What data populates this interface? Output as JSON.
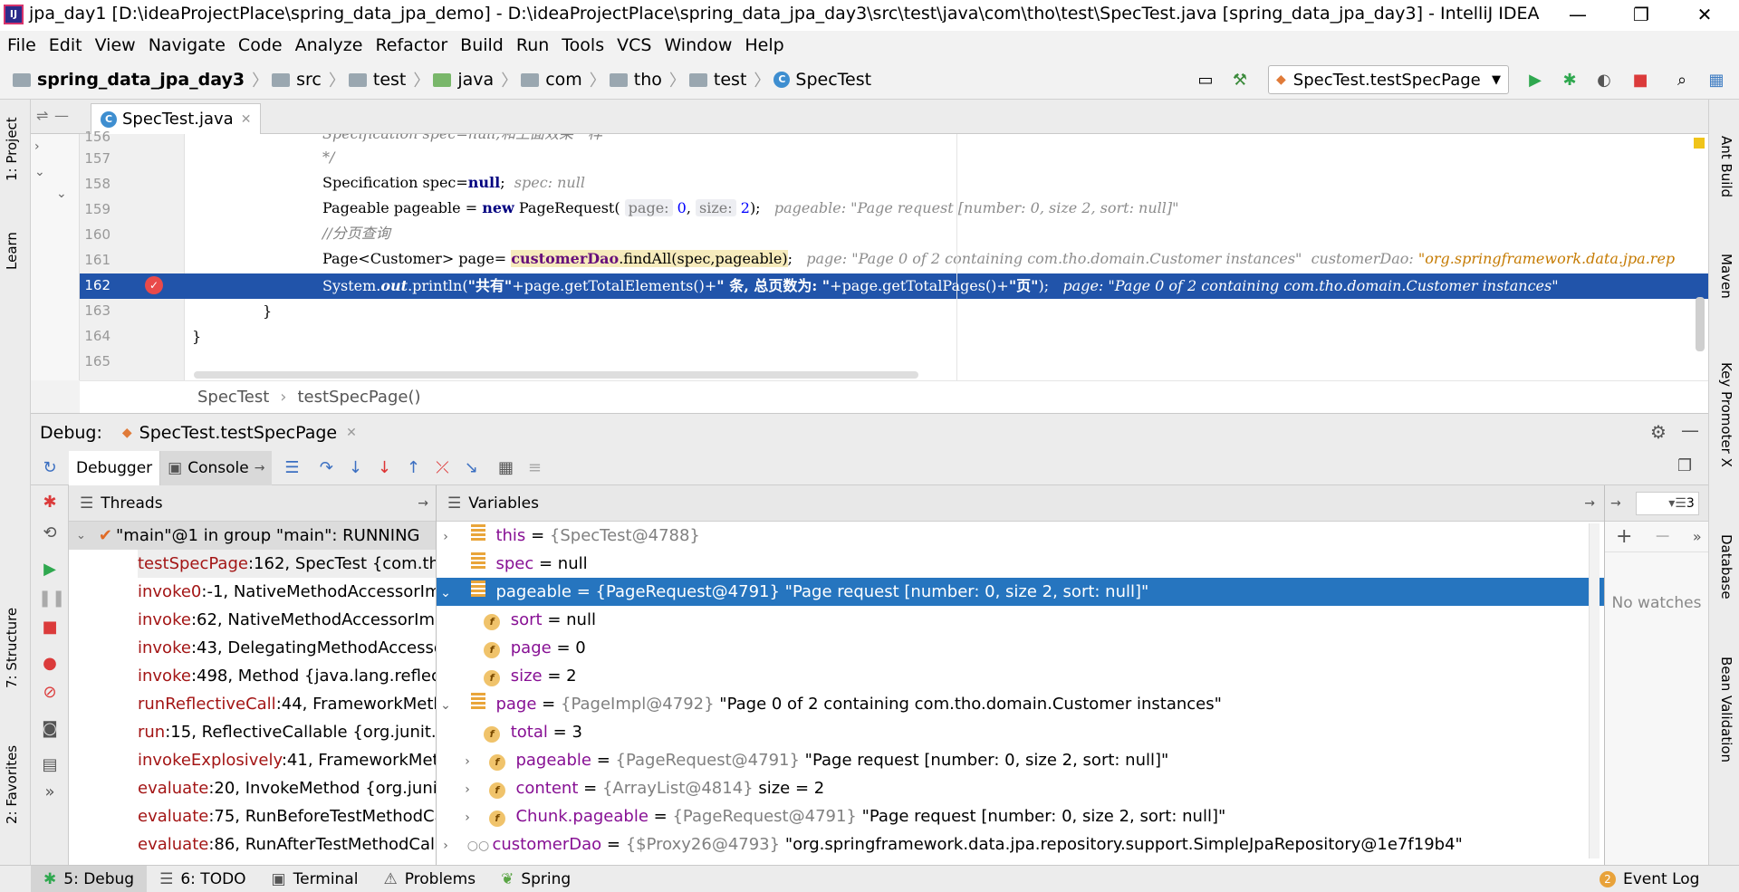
{
  "window": {
    "title": "jpa_day1 [D:\\ideaProjectPlace\\spring_data_jpa_demo] - D:\\ideaProjectPlace\\spring_data_jpa_day3\\src\\test\\java\\com\\tho\\test\\SpecTest.java [spring_data_jpa_day3] - IntelliJ IDEA",
    "minimize": "—",
    "restore": "❐",
    "close": "✕"
  },
  "menu": [
    "File",
    "Edit",
    "View",
    "Navigate",
    "Code",
    "Analyze",
    "Refactor",
    "Build",
    "Run",
    "Tools",
    "VCS",
    "Window",
    "Help"
  ],
  "breadcrumb": [
    "spring_data_jpa_day3",
    "src",
    "test",
    "java",
    "com",
    "tho",
    "test",
    "SpecTest"
  ],
  "run_config": "SpecTest.testSpecPage",
  "left_tabs": {
    "project": "1: Project",
    "learn": "Learn",
    "structure": "7: Structure",
    "favorites": "2: Favorites"
  },
  "right_tabs": {
    "ant": "Ant Build",
    "maven": "Maven",
    "keypromoter": "Key Promoter X",
    "database": "Database",
    "bean": "Bean Validation"
  },
  "editor": {
    "tab": "SpecTest.java",
    "lines": {
      "n156": "156",
      "n157": "157",
      "n158": "158",
      "n159": "159",
      "n160": "160",
      "n161": "161",
      "n162": "162",
      "n163": "163",
      "n164": "164",
      "n165": "165"
    },
    "l156": "Specification spec=null;和上面效果一样",
    "l157": "*/",
    "l158_code": "Specification spec=",
    "l158_kw": "null",
    "l158_end": ";",
    "l158_hint": "spec: null",
    "l159_a": "Pageable pageable = ",
    "l159_new": "new",
    "l159_b": " PageRequest(",
    "l159_p1": "page:",
    "l159_v1": "0",
    "l159_sep": ",",
    "l159_p2": "size:",
    "l159_v2": "2",
    "l159_end": ");",
    "l159_hint": "pageable: \"Page request [number: 0, size 2, sort: null]\"",
    "l160": "//分页查询",
    "l161_a": "Page<Customer> page= ",
    "l161_dao": "customerDao",
    "l161_b": ".findAll(spec,pageable)",
    "l161_end": ";",
    "l161_hint1": "page: \"Page 0 of 2 containing com.tho.domain.Customer instances\"",
    "l161_hint2": "customerDao:",
    "l161_hint3": "\"org.springframework.data.jpa.rep",
    "l162_a": "System.",
    "l162_out": "out",
    "l162_b": ".println(",
    "l162_s1": "\"共有\"",
    "l162_c": "+page.getTotalElements()+",
    "l162_s2": "\" 条, 总页数为: \"",
    "l162_d": "+page.getTotalPages()+",
    "l162_s3": "\"页\"",
    "l162_end": ");",
    "l162_hint": "page: \"Page 0 of 2 containing com.tho.domain.Customer instances\"",
    "l163": "}",
    "l164": "}",
    "l165": ""
  },
  "editor_breadcrumb": [
    "SpecTest",
    "testSpecPage()"
  ],
  "debug": {
    "label": "Debug:",
    "session": "SpecTest.testSpecPage",
    "tabs": {
      "debugger": "Debugger",
      "console": "Console"
    },
    "threads_title": "Threads",
    "thread_main": "\"main\"@1 in group \"main\": RUNNING",
    "frames": [
      {
        "method": "testSpecPage",
        "rest": ":162, SpecTest {com.tho.t"
      },
      {
        "method": "invoke0",
        "rest": ":-1, NativeMethodAccessorImp"
      },
      {
        "method": "invoke",
        "rest": ":62, NativeMethodAccessorImpl"
      },
      {
        "method": "invoke",
        "rest": ":43, DelegatingMethodAccessor"
      },
      {
        "method": "invoke",
        "rest": ":498, Method {java.lang.reflect}"
      },
      {
        "method": "runReflectiveCall",
        "rest": ":44, FrameworkMetho"
      },
      {
        "method": "run",
        "rest": ":15, ReflectiveCallable {org.junit.int"
      },
      {
        "method": "invokeExplosively",
        "rest": ":41, FrameworkMeth"
      },
      {
        "method": "evaluate",
        "rest": ":20, InvokeMethod {org.junit.i"
      },
      {
        "method": "evaluate",
        "rest": ":75, RunBeforeTestMethodCal"
      },
      {
        "method": "evaluate",
        "rest": ":86, RunAfterTestMethodCallb"
      }
    ],
    "variables_title": "Variables",
    "vars": [
      {
        "name": "this",
        "ref": "{SpecTest@4788}",
        "val": ""
      },
      {
        "name": "spec",
        "ref": "",
        "val": "= null"
      },
      {
        "name": "pageable",
        "ref": "{PageRequest@4791}",
        "val": "\"Page request [number: 0, size 2, sort: null]\""
      },
      {
        "name": "sort",
        "ref": "",
        "val": "= null"
      },
      {
        "name": "page",
        "ref": "",
        "val": "= 0"
      },
      {
        "name": "size",
        "ref": "",
        "val": "= 2"
      },
      {
        "name": "page",
        "ref": "{PageImpl@4792}",
        "val": "\"Page 0 of 2 containing com.tho.domain.Customer instances\""
      },
      {
        "name": "total",
        "ref": "",
        "val": "= 3"
      },
      {
        "name": "pageable",
        "ref": "{PageRequest@4791}",
        "val": "\"Page request [number: 0, size 2, sort: null]\""
      },
      {
        "name": "content",
        "ref": "{ArrayList@4814}",
        "val": " size = 2"
      },
      {
        "name": "Chunk.pageable",
        "ref": "{PageRequest@4791}",
        "val": "\"Page request [number: 0, size 2, sort: null]\""
      },
      {
        "name": "customerDao",
        "ref": "{$Proxy26@4793}",
        "val": "\"org.springframework.data.jpa.repository.support.SimpleJpaRepository@1e7f19b4\""
      }
    ],
    "watches_empty": "No watches",
    "watches_count": "3"
  },
  "status": {
    "debug": "5: Debug",
    "todo": "6: TODO",
    "terminal": "Terminal",
    "problems": "Problems",
    "spring": "Spring",
    "event_badge": "2",
    "event_log": "Event Log"
  }
}
